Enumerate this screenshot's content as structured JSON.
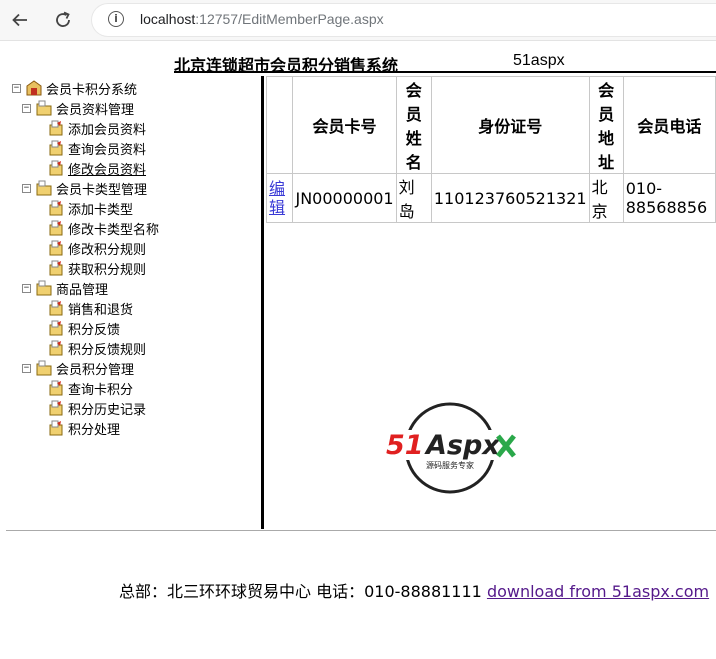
{
  "browser": {
    "url_host": "localhost",
    "url_rest": ":12757/EditMemberPage.aspx"
  },
  "header": {
    "title": "北京连锁超市会员积分销售系统",
    "subtitle": "51aspx"
  },
  "tree": {
    "root": "会员卡积分系统",
    "groups": [
      {
        "label": "会员资料管理",
        "items": [
          "添加会员资料",
          "查询会员资料",
          "修改会员资料"
        ]
      },
      {
        "label": "会员卡类型管理",
        "items": [
          "添加卡类型",
          "修改卡类型名称",
          "修改积分规则",
          "获取积分规则"
        ]
      },
      {
        "label": "商品管理",
        "items": [
          "销售和退货",
          "积分反馈",
          "积分反馈规则"
        ]
      },
      {
        "label": "会员积分管理",
        "items": [
          "查询卡积分",
          "积分历史记录",
          "积分处理"
        ]
      }
    ]
  },
  "grid": {
    "headers": [
      "",
      "会员卡号",
      "会员\n姓名",
      "身份证号",
      "会员\n地址",
      "会员电话"
    ],
    "rows": [
      {
        "edit": "编辑",
        "card_no": "JN00000001",
        "name": "刘岛",
        "id_no": "110123760521321",
        "address": "北京",
        "phone": "010-88568856"
      }
    ]
  },
  "logo": {
    "text": "51Aspx",
    "tagline": "源码服务专家"
  },
  "footer": {
    "text": "总部：北三环环球贸易中心 电话：010-88881111",
    "link": "download from 51aspx.com"
  },
  "colors": {
    "link": "#3a3ad6",
    "visited_link": "#551a8b",
    "logo_red": "#e02020",
    "logo_green": "#2aa84a"
  }
}
